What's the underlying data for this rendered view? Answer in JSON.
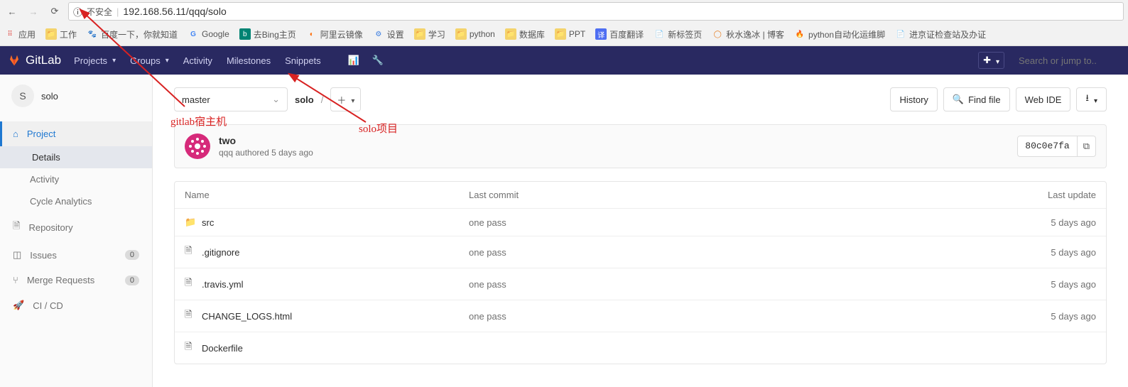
{
  "browser": {
    "url": "192.168.56.11/qqq/solo",
    "insecure_label": "不安全",
    "bookmarks": [
      {
        "icon": "apps",
        "label": "应用"
      },
      {
        "icon": "folder",
        "label": "工作"
      },
      {
        "icon": "baidu",
        "label": "百度一下，你就知道"
      },
      {
        "icon": "google",
        "label": "Google"
      },
      {
        "icon": "bing",
        "label": "去Bing主页"
      },
      {
        "icon": "aliyun",
        "label": "阿里云镜像"
      },
      {
        "icon": "gear",
        "label": "设置"
      },
      {
        "icon": "folder",
        "label": "学习"
      },
      {
        "icon": "folder",
        "label": "python"
      },
      {
        "icon": "folder",
        "label": "数据库"
      },
      {
        "icon": "folder",
        "label": "PPT"
      },
      {
        "icon": "trans",
        "label": "百度翻译"
      },
      {
        "icon": "doc",
        "label": "新标签页"
      },
      {
        "icon": "blog",
        "label": "秋水逸冰 | 博客"
      },
      {
        "icon": "fire",
        "label": "python自动化运维脚"
      },
      {
        "icon": "doc",
        "label": "进京证检查站及办证"
      }
    ]
  },
  "gitlab": {
    "brand": "GitLab",
    "top_menu": [
      "Projects",
      "Groups",
      "Activity",
      "Milestones",
      "Snippets"
    ],
    "search_placeholder": "Search or jump to..",
    "project": {
      "initial": "S",
      "name": "solo"
    }
  },
  "sidebar": {
    "sections": [
      {
        "icon": "home",
        "label": "Project",
        "active": true,
        "subs": [
          {
            "label": "Details",
            "selected": true
          },
          {
            "label": "Activity"
          },
          {
            "label": "Cycle Analytics"
          }
        ]
      },
      {
        "icon": "repo",
        "label": "Repository"
      },
      {
        "icon": "issues",
        "label": "Issues",
        "count": "0"
      },
      {
        "icon": "mr",
        "label": "Merge Requests",
        "count": "0"
      },
      {
        "icon": "cicd",
        "label": "CI / CD"
      }
    ]
  },
  "content": {
    "branch": "master",
    "crumb_root": "solo",
    "buttons": {
      "history": "History",
      "find": "Find file",
      "webide": "Web IDE"
    },
    "commit": {
      "title": "two",
      "author": "qqq",
      "meta": "authored 5 days ago",
      "sha": "80c0e7fa"
    },
    "table": {
      "headers": {
        "name": "Name",
        "commit": "Last commit",
        "update": "Last update"
      },
      "rows": [
        {
          "type": "dir",
          "name": "src",
          "commit": "one pass",
          "update": "5 days ago"
        },
        {
          "type": "file",
          "name": ".gitignore",
          "commit": "one pass",
          "update": "5 days ago"
        },
        {
          "type": "file",
          "name": ".travis.yml",
          "commit": "one pass",
          "update": "5 days ago"
        },
        {
          "type": "file",
          "name": "CHANGE_LOGS.html",
          "commit": "one pass",
          "update": "5 days ago"
        },
        {
          "type": "file",
          "name": "Dockerfile",
          "commit": "",
          "update": ""
        }
      ]
    }
  },
  "annotations": {
    "a1": "gitlab宿主机",
    "a2": "solo项目"
  }
}
